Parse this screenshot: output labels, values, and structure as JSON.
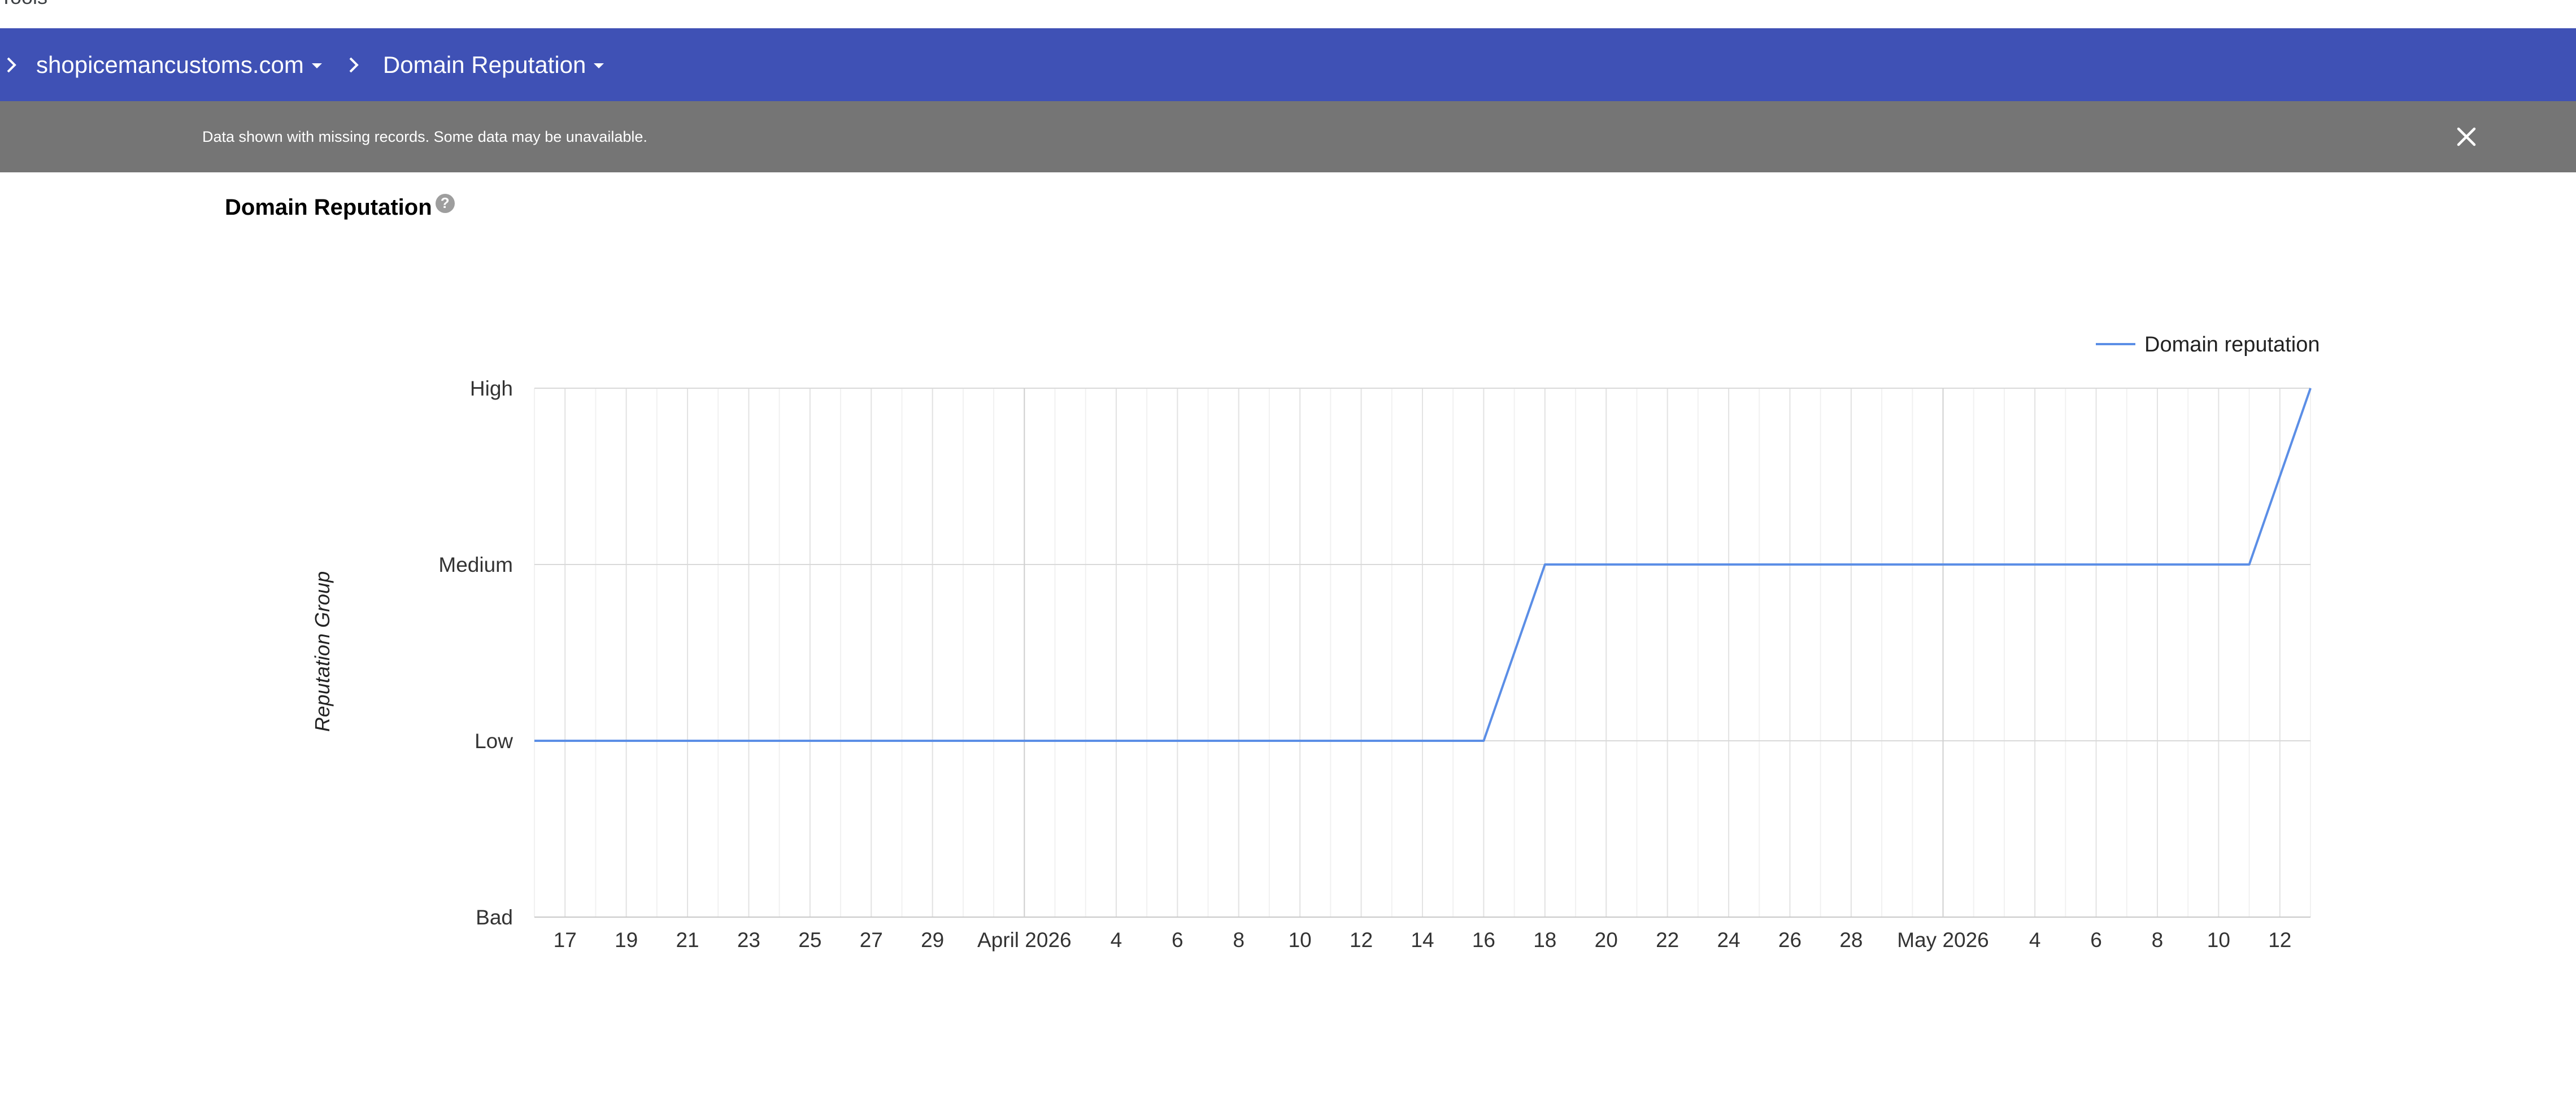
{
  "top_strip": {
    "partial_text": "Tools"
  },
  "breadcrumb": {
    "items": [
      {
        "label": "shopicemancustoms.com"
      },
      {
        "label": "Domain Reputation"
      }
    ]
  },
  "banner": {
    "message": "Data shown with missing records. Some data may be unavailable."
  },
  "section": {
    "title": "Domain Reputation"
  },
  "colors": {
    "app_bar": "#3f51b5",
    "banner": "#757575",
    "series_line": "#5b8ee6"
  },
  "icons": [
    "chevron-right-icon",
    "caret-down-icon",
    "close-icon",
    "help-icon"
  ],
  "chart_data": {
    "type": "line",
    "ylabel": "Reputation Group",
    "y_categories": [
      "Bad",
      "Low",
      "Medium",
      "High"
    ],
    "x_ticks": [
      "17",
      "19",
      "21",
      "23",
      "25",
      "27",
      "29",
      "April 2026",
      "4",
      "6",
      "8",
      "10",
      "12",
      "14",
      "16",
      "18",
      "20",
      "22",
      "24",
      "26",
      "28",
      "May 2026",
      "4",
      "6",
      "8",
      "10",
      "12"
    ],
    "x_range": [
      "2026-03-16",
      "2026-05-13"
    ],
    "legend": {
      "position": "top-right"
    },
    "grid": true,
    "series": [
      {
        "name": "Domain reputation",
        "points": [
          {
            "x": "2026-03-16",
            "y": "Low"
          },
          {
            "x": "2026-04-16",
            "y": "Low"
          },
          {
            "x": "2026-04-18",
            "y": "Medium"
          },
          {
            "x": "2026-05-11",
            "y": "Medium"
          },
          {
            "x": "2026-05-13",
            "y": "High"
          }
        ]
      }
    ]
  }
}
